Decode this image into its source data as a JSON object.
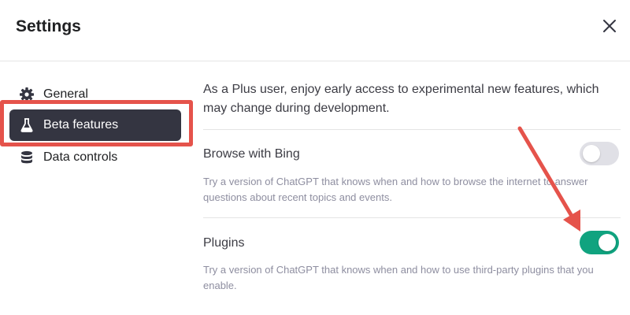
{
  "dialog": {
    "title": "Settings",
    "close_icon": "close-icon"
  },
  "sidebar": {
    "items": [
      {
        "label": "General",
        "icon": "gear-icon",
        "active": false
      },
      {
        "label": "Beta features",
        "icon": "flask-icon",
        "active": true
      },
      {
        "label": "Data controls",
        "icon": "database-icon",
        "active": false
      }
    ]
  },
  "content": {
    "intro": "As a Plus user, enjoy early access to experimental new features, which may change during development.",
    "features": [
      {
        "title": "Browse with Bing",
        "description": "Try a version of ChatGPT that knows when and how to browse the internet to answer questions about recent topics and events.",
        "enabled": false
      },
      {
        "title": "Plugins",
        "description": "Try a version of ChatGPT that knows when and how to use third-party plugins that you enable.",
        "enabled": true
      }
    ]
  },
  "colors": {
    "active_item_bg": "#343541",
    "toggle_on": "#10a37f",
    "toggle_off": "#e0e0e6",
    "annotation": "#e5534b"
  }
}
